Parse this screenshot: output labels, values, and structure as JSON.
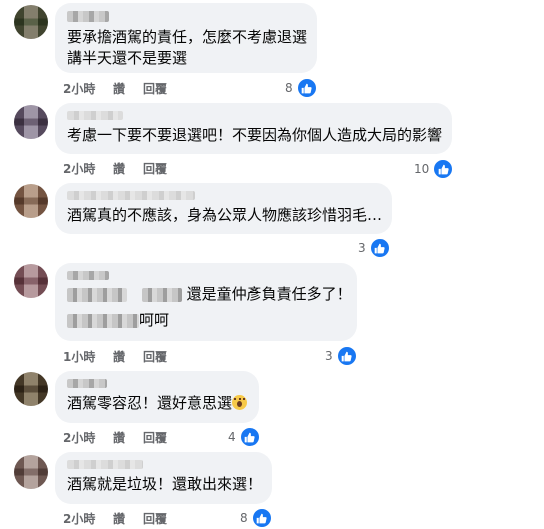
{
  "comments": [
    {
      "lines": [
        "要承擔酒駕的責任，怎麼不考慮退選",
        "講半天還不是要選"
      ],
      "time": "2小時",
      "like_label": "讚",
      "reply_label": "回覆",
      "reactions": "8",
      "avatar_colors": [
        "#7d8a6e",
        "#b7b3a6"
      ]
    },
    {
      "lines": [
        "考慮一下要不要退選吧！不要因為你個人造成大局的影響"
      ],
      "time": "2小時",
      "like_label": "讚",
      "reply_label": "回覆",
      "reactions": "10",
      "avatar_colors": [
        "#8a7f8f",
        "#c9c3ce"
      ]
    },
    {
      "lines": [
        "酒駕真的不應該，身為公眾人物應該珍惜羽毛…"
      ],
      "time": "2小時",
      "like_label": "讚",
      "reply_label": "回覆",
      "reactions": "3",
      "avatar_colors": [
        "#a08878",
        "#d9c9bc"
      ]
    },
    {
      "line1_suffix": "還是童仲彥負責任多了！",
      "line2_suffix": "呵呵",
      "time": "1小時",
      "like_label": "讚",
      "reply_label": "回覆",
      "reactions": "3",
      "avatar_colors": [
        "#a17f87",
        "#d8c6c9"
      ]
    },
    {
      "text": "酒駕零容忍！還好意思選",
      "emoji": "face-with-hand-over-mouth",
      "time": "2小時",
      "like_label": "讚",
      "reply_label": "回覆",
      "reactions": "4",
      "avatar_colors": [
        "#7a6e5c",
        "#bfb6a5"
      ]
    },
    {
      "lines": [
        "酒駕就是垃圾！還敢出來選！"
      ],
      "time": "2小時",
      "like_label": "讚",
      "reply_label": "回覆",
      "reactions": "8",
      "avatar_colors": [
        "#9c8a86",
        "#d6ccc8"
      ]
    }
  ],
  "colors": {
    "bubble": "#f0f2f5",
    "like_blue": "#1877f2",
    "meta_gray": "#65676b"
  },
  "icons": {
    "reaction": "thumbs-up-icon"
  }
}
